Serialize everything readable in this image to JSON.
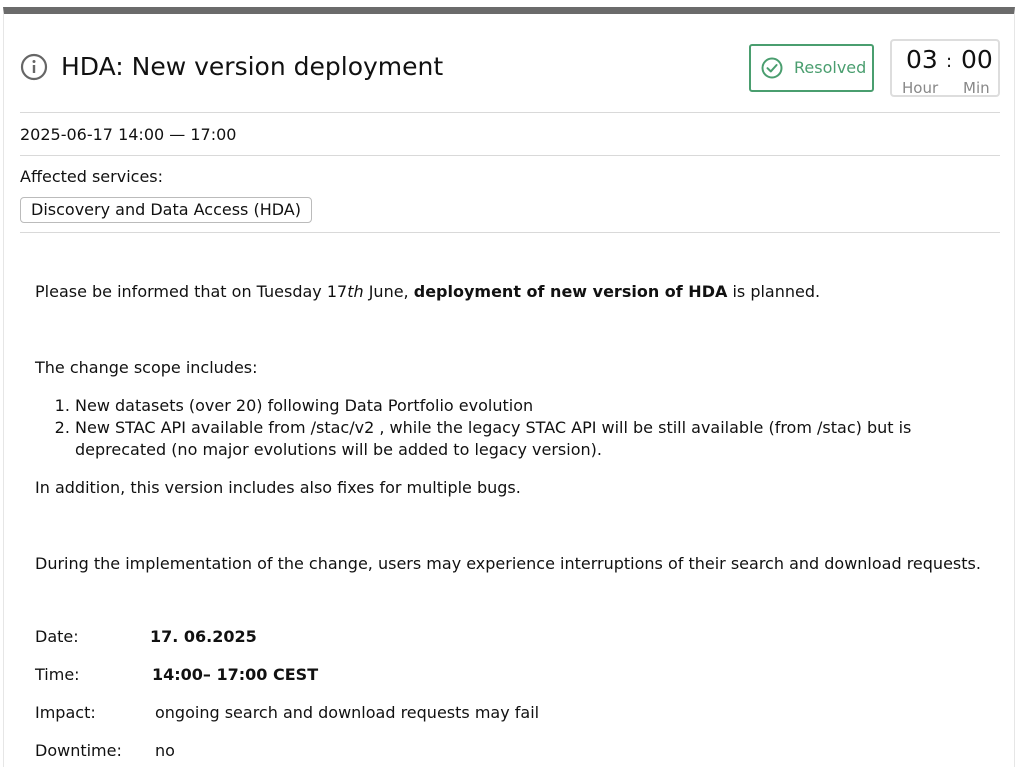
{
  "incident": {
    "title": "HDA: New version deployment",
    "status": "Resolved",
    "duration": {
      "hours": "03",
      "minutes": "00",
      "separator": ":",
      "hour_label": "Hour",
      "minute_label": "Min"
    },
    "date_range": "2025-06-17 14:00  —  17:00",
    "affected_label": "Affected services:",
    "services": [
      "Discovery and Data Access (HDA)"
    ]
  },
  "body": {
    "p1_pre": "Please be informed that on Tuesday 17",
    "p1_sup": "th",
    "p1_mid": " June, ",
    "p1_bold": "deployment of new version of HDA",
    "p1_post": " is planned.",
    "p2": "The change scope includes:",
    "list": [
      "New datasets (over 20) following Data Portfolio evolution",
      "New STAC API available from /stac/v2 , while the legacy STAC API will be still available (from /stac) but is deprecated (no major evolutions will be added to legacy version)."
    ],
    "p3": "In addition, this version includes also fixes for multiple bugs.",
    "p4": "During the implementation of the change, users may experience interruptions of their search and download requests."
  },
  "details": {
    "date_label": "Date:",
    "date_value": "17. 06.2025",
    "time_label": "Time:",
    "time_value": "14:00– 17:00 CEST",
    "impact_label": "Impact:",
    "impact_value": "ongoing search and download requests may fail",
    "downtime_label": "Downtime:",
    "downtime_value": "no"
  },
  "colors": {
    "resolved": "#4a9e6f",
    "top_bar": "#6b6b6b",
    "muted": "#888888"
  }
}
